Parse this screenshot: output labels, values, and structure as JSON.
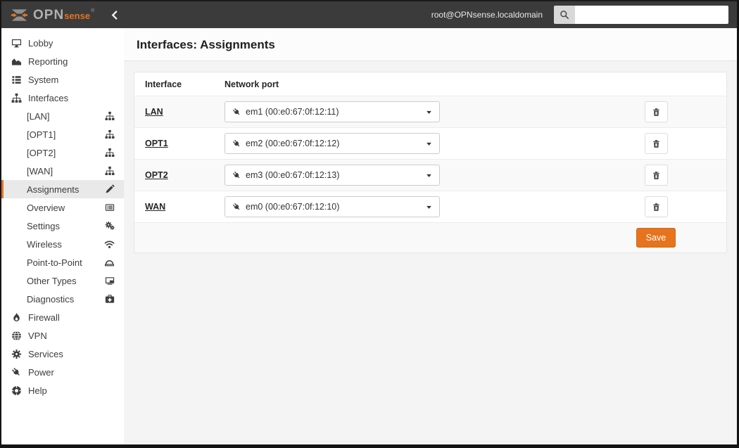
{
  "topbar": {
    "brand_opn": "OPN",
    "brand_sense": "sense",
    "brand_reg": "®",
    "user": "root@OPNsense.localdomain"
  },
  "page": {
    "title": "Interfaces: Assignments"
  },
  "sidebar": {
    "top": [
      {
        "label": "Lobby"
      },
      {
        "label": "Reporting"
      },
      {
        "label": "System"
      },
      {
        "label": "Interfaces"
      }
    ],
    "interfaces_children": [
      {
        "label": "[LAN]"
      },
      {
        "label": "[OPT1]"
      },
      {
        "label": "[OPT2]"
      },
      {
        "label": "[WAN]"
      },
      {
        "label": "Assignments"
      },
      {
        "label": "Overview"
      },
      {
        "label": "Settings"
      },
      {
        "label": "Wireless"
      },
      {
        "label": "Point-to-Point"
      },
      {
        "label": "Other Types"
      },
      {
        "label": "Diagnostics"
      }
    ],
    "bottom": [
      {
        "label": "Firewall"
      },
      {
        "label": "VPN"
      },
      {
        "label": "Services"
      },
      {
        "label": "Power"
      },
      {
        "label": "Help"
      }
    ]
  },
  "assignments": {
    "col_interface": "Interface",
    "col_network_port": "Network port",
    "rows": [
      {
        "interface": "LAN",
        "port": "em1 (00:e0:67:0f:12:11)"
      },
      {
        "interface": "OPT1",
        "port": "em2 (00:e0:67:0f:12:12)"
      },
      {
        "interface": "OPT2",
        "port": "em3 (00:e0:67:0f:12:13)"
      },
      {
        "interface": "WAN",
        "port": "em0 (00:e0:67:0f:12:10)"
      }
    ],
    "save_label": "Save"
  },
  "colors": {
    "accent": "#e6731e",
    "topbar": "#3b3b3b"
  }
}
